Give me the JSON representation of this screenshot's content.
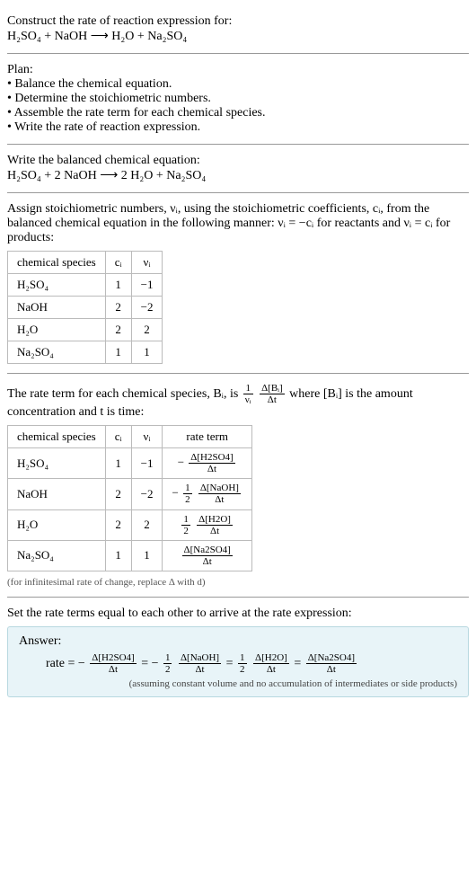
{
  "intro": {
    "line1": "Construct the rate of reaction expression for:",
    "equation": "H₂SO₄ + NaOH ⟶ H₂O + Na₂SO₄"
  },
  "plan": {
    "heading": "Plan:",
    "items": [
      "• Balance the chemical equation.",
      "• Determine the stoichiometric numbers.",
      "• Assemble the rate term for each chemical species.",
      "• Write the rate of reaction expression."
    ]
  },
  "balanced": {
    "heading": "Write the balanced chemical equation:",
    "equation": "H₂SO₄ + 2 NaOH ⟶ 2 H₂O + Na₂SO₄"
  },
  "stoich_text": {
    "part1": "Assign stoichiometric numbers, νᵢ, using the stoichiometric coefficients, cᵢ, from the balanced chemical equation in the following manner: νᵢ = −cᵢ for reactants and νᵢ = cᵢ for products:"
  },
  "table1": {
    "headers": [
      "chemical species",
      "cᵢ",
      "νᵢ"
    ],
    "rows": [
      [
        "H₂SO₄",
        "1",
        "−1"
      ],
      [
        "NaOH",
        "2",
        "−2"
      ],
      [
        "H₂O",
        "2",
        "2"
      ],
      [
        "Na₂SO₄",
        "1",
        "1"
      ]
    ]
  },
  "rate_term_text": {
    "part1": "The rate term for each chemical species, Bᵢ, is ",
    "frac1_num": "1",
    "frac1_den": "νᵢ",
    "frac2_num": "Δ[Bᵢ]",
    "frac2_den": "Δt",
    "part2": " where [Bᵢ] is the amount concentration and t is time:"
  },
  "table2": {
    "headers": [
      "chemical species",
      "cᵢ",
      "νᵢ",
      "rate term"
    ],
    "rows": [
      {
        "sp": "H₂SO₄",
        "c": "1",
        "v": "−1",
        "pre": "−",
        "coef_num": "",
        "coef_den": "",
        "num": "Δ[H2SO4]",
        "den": "Δt"
      },
      {
        "sp": "NaOH",
        "c": "2",
        "v": "−2",
        "pre": "−",
        "coef_num": "1",
        "coef_den": "2",
        "num": "Δ[NaOH]",
        "den": "Δt"
      },
      {
        "sp": "H₂O",
        "c": "2",
        "v": "2",
        "pre": "",
        "coef_num": "1",
        "coef_den": "2",
        "num": "Δ[H2O]",
        "den": "Δt"
      },
      {
        "sp": "Na₂SO₄",
        "c": "1",
        "v": "1",
        "pre": "",
        "coef_num": "",
        "coef_den": "",
        "num": "Δ[Na2SO4]",
        "den": "Δt"
      }
    ],
    "note": "(for infinitesimal rate of change, replace Δ with d)"
  },
  "final_text": "Set the rate terms equal to each other to arrive at the rate expression:",
  "answer": {
    "label": "Answer:",
    "rate_lead": "rate = −",
    "t1_num": "Δ[H2SO4]",
    "t1_den": "Δt",
    "eq1": " = −",
    "c2_num": "1",
    "c2_den": "2",
    "t2_num": "Δ[NaOH]",
    "t2_den": "Δt",
    "eq2": " = ",
    "c3_num": "1",
    "c3_den": "2",
    "t3_num": "Δ[H2O]",
    "t3_den": "Δt",
    "eq3": " = ",
    "t4_num": "Δ[Na2SO4]",
    "t4_den": "Δt",
    "note": "(assuming constant volume and no accumulation of intermediates or side products)"
  }
}
